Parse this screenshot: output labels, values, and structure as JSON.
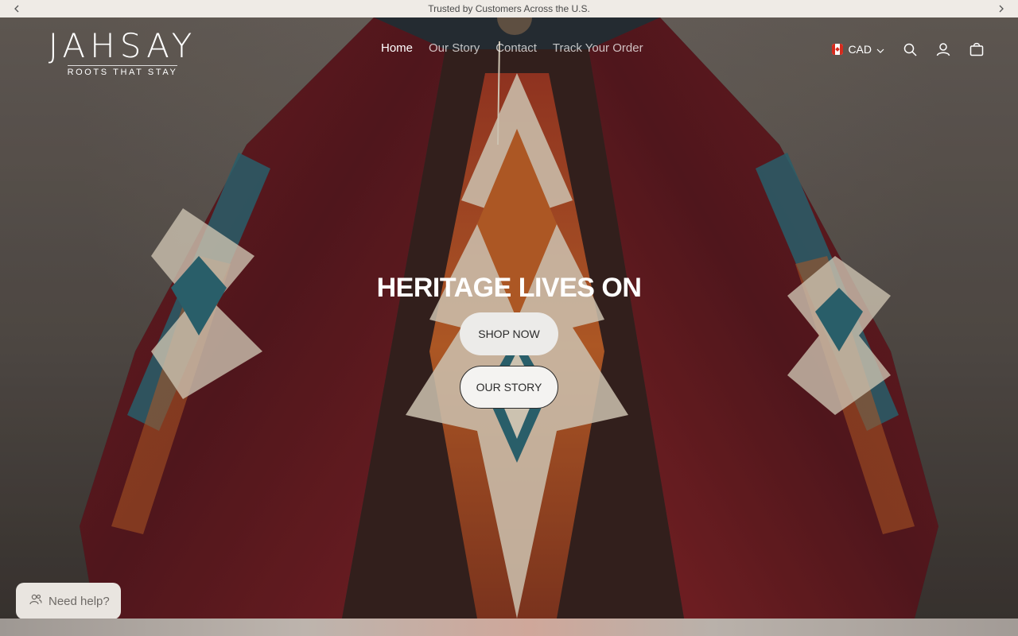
{
  "announcement": {
    "text": "Trusted by Customers Across the U.S."
  },
  "header": {
    "logo_name": "JAHSAY",
    "logo_tagline": "ROOTS THAT STAY",
    "nav": [
      {
        "label": "Home",
        "active": true
      },
      {
        "label": "Our Story",
        "active": false
      },
      {
        "label": "Contact",
        "active": false
      },
      {
        "label": "Track Your Order",
        "active": false
      }
    ],
    "currency": "CAD"
  },
  "hero": {
    "title": "HERITAGE LIVES ON",
    "primary_button": "SHOP NOW",
    "secondary_button": "OUR STORY"
  },
  "chat": {
    "label": "Need help?"
  },
  "colors": {
    "announcement_bg": "#efebe6",
    "button_bg": "#ecebe9",
    "poncho_red": "#7a1f24",
    "poncho_teal": "#2f6b78",
    "poncho_orange": "#c4632a",
    "poncho_cream": "#e9ddc9"
  },
  "icons": [
    "chevron-left-icon",
    "chevron-right-icon",
    "canada-flag-icon",
    "chevron-down-icon",
    "search-icon",
    "account-icon",
    "cart-icon",
    "people-icon"
  ]
}
